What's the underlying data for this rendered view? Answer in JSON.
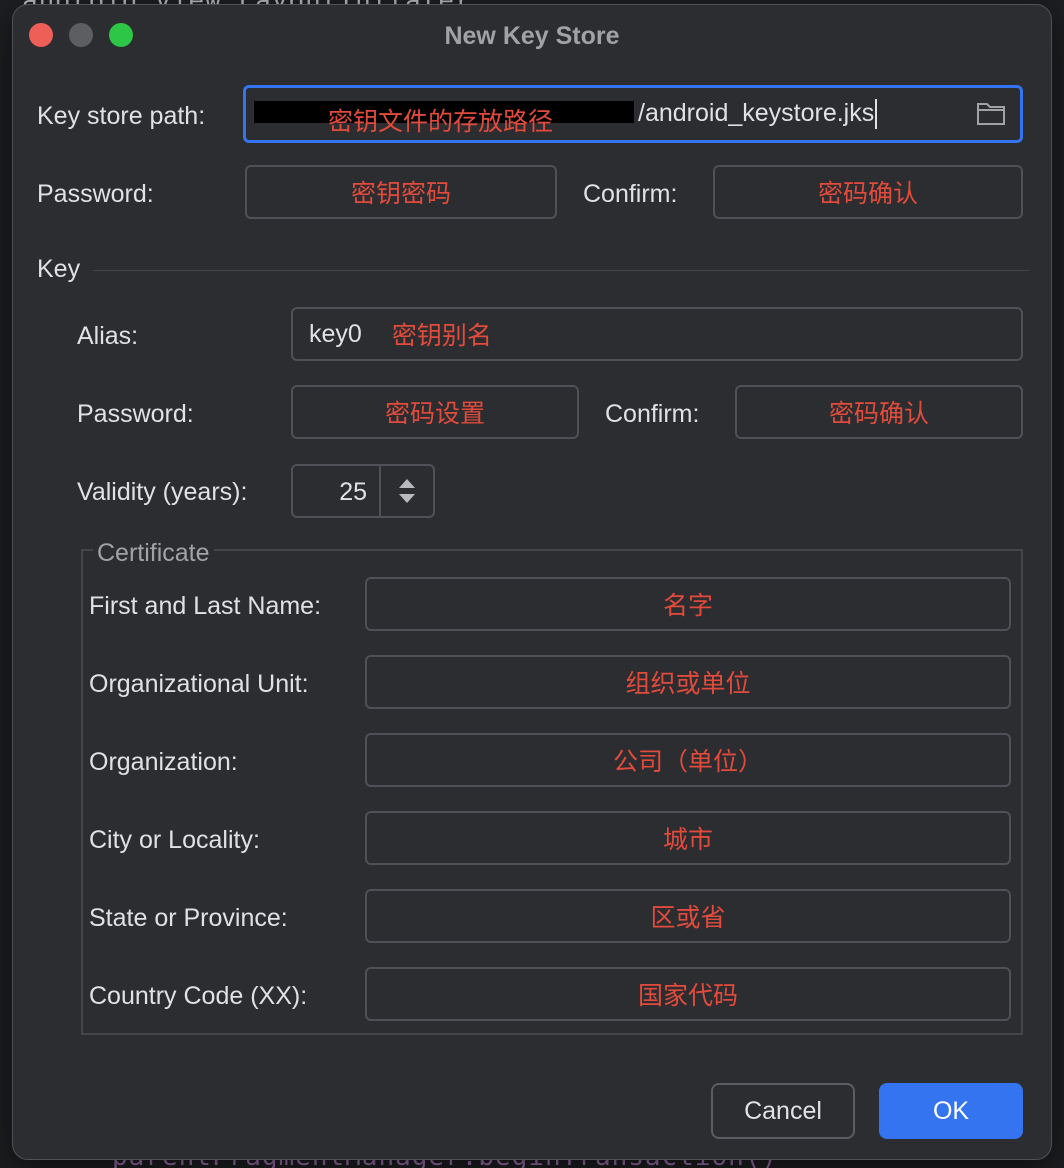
{
  "background": {
    "code_top": "android.view.LayoutInflater;",
    "code_bottom": "parentFragmentManager.beginTransaction()"
  },
  "dialog": {
    "title": "New Key Store",
    "keystore": {
      "path_label": "Key store path:",
      "path_value": "/android_keystore.jks",
      "path_annotation": "密钥文件的存放路径",
      "folder_icon": "folder-icon",
      "password_label": "Password:",
      "password_hint": "密钥密码",
      "confirm_label": "Confirm:",
      "confirm_hint": "密码确认"
    },
    "key": {
      "section_label": "Key",
      "alias_label": "Alias:",
      "alias_value": "key0",
      "alias_hint": "密钥别名",
      "password_label": "Password:",
      "password_hint": "密码设置",
      "confirm_label": "Confirm:",
      "confirm_hint": "密码确认",
      "validity_label": "Validity (years):",
      "validity_value": "25"
    },
    "certificate": {
      "title": "Certificate",
      "fields": [
        {
          "label": "First and Last Name:",
          "hint": "名字"
        },
        {
          "label": "Organizational Unit:",
          "hint": "组织或单位"
        },
        {
          "label": "Organization:",
          "hint": "公司（单位）"
        },
        {
          "label": "City or Locality:",
          "hint": "城市"
        },
        {
          "label": "State or Province:",
          "hint": "区或省"
        },
        {
          "label": "Country Code (XX):",
          "hint": "国家代码"
        }
      ]
    },
    "buttons": {
      "cancel": "Cancel",
      "ok": "OK"
    },
    "colors": {
      "accent": "#3574f0",
      "annotation": "#e24b3c",
      "close": "#ee5f57",
      "maximize": "#2ec646"
    }
  }
}
